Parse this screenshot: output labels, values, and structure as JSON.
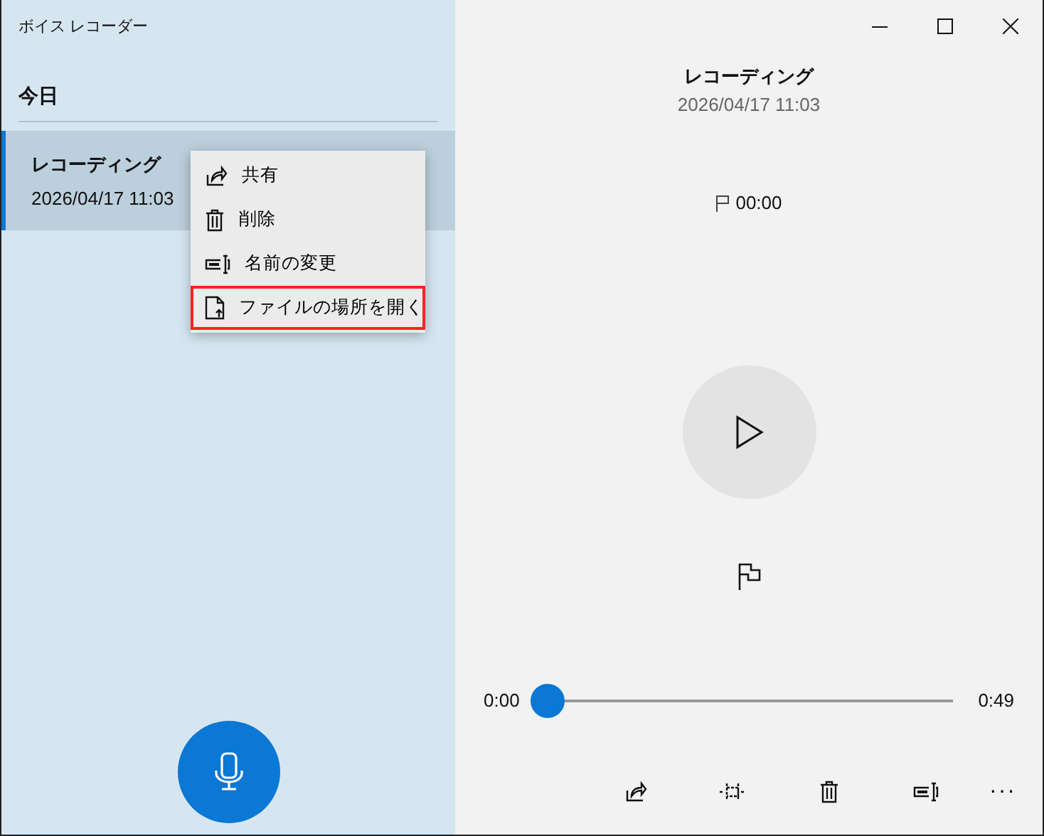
{
  "window": {
    "title": "ボイス レコーダー"
  },
  "sidebar": {
    "group_header": "今日",
    "recordings": [
      {
        "name": "レコーディング",
        "date": "2026/04/17 11:03",
        "selected": true
      }
    ],
    "record_button": {
      "kind": "microphone"
    }
  },
  "context_menu": {
    "items": [
      {
        "kind": "share",
        "label": "共有",
        "highlighted": false
      },
      {
        "kind": "delete",
        "label": "削除",
        "highlighted": false
      },
      {
        "kind": "rename",
        "label": "名前の変更",
        "highlighted": false
      },
      {
        "kind": "open-folder",
        "label": "ファイルの場所を開く",
        "highlighted": true
      }
    ]
  },
  "player": {
    "title": "レコーディング",
    "date": "2026/04/17 11:03",
    "marker": "00:00",
    "position": "0:00",
    "duration": "0:49",
    "level": 0
  },
  "toolbar": [
    {
      "kind": "share"
    },
    {
      "kind": "trim"
    },
    {
      "kind": "delete"
    },
    {
      "kind": "rename"
    },
    {
      "kind": "more",
      "label": "···"
    }
  ]
}
